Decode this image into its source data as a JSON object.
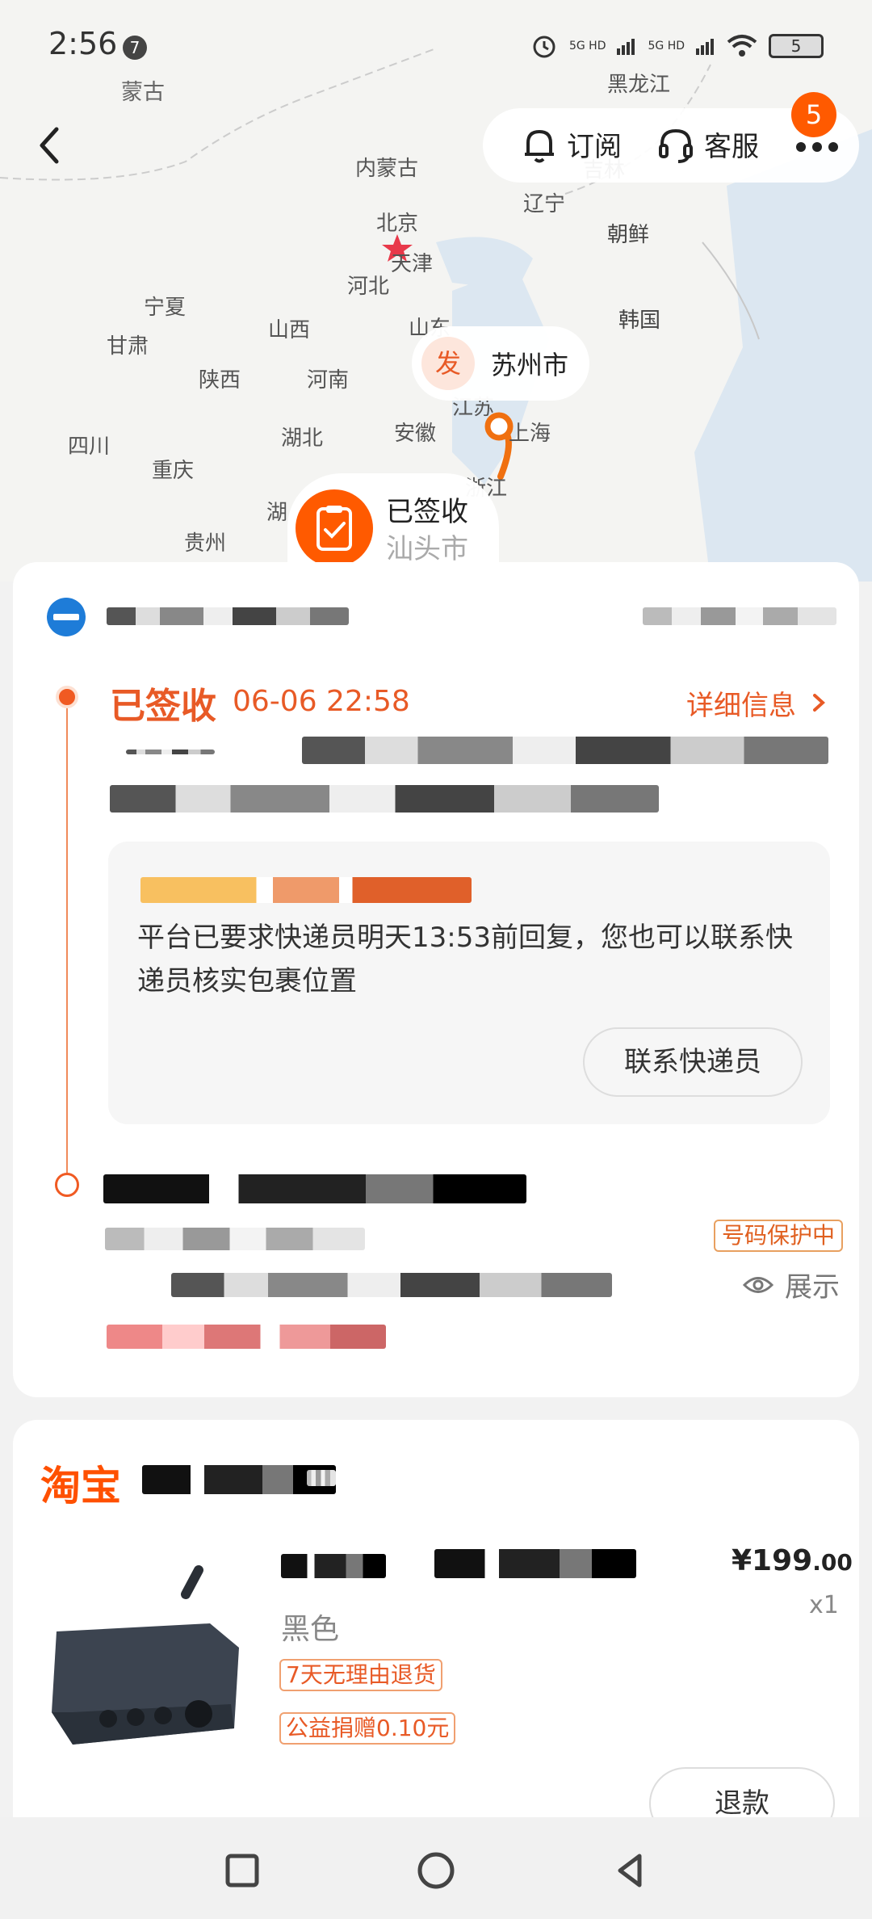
{
  "status_bar": {
    "time": "2:56",
    "notification_count": "7",
    "signal_1": "5G HD",
    "signal_2": "5G HD",
    "battery": "5"
  },
  "map": {
    "labels": [
      "蒙古",
      "黑龙江",
      "内蒙古",
      "吉林",
      "辽宁",
      "朝鲜",
      "北京",
      "天津",
      "河北",
      "宁夏",
      "甘肃",
      "山西",
      "山东",
      "韩国",
      "陕西",
      "河南",
      "四川",
      "湖北",
      "安徽",
      "江苏",
      "上海",
      "重庆",
      "浙江",
      "湖",
      "贵州"
    ]
  },
  "nav": {
    "subscribe_label": "订阅",
    "service_label": "客服",
    "more_badge": "5"
  },
  "route": {
    "origin_tag": "发",
    "origin_city": "苏州市",
    "dest_status": "已签收",
    "dest_city": "汕头市"
  },
  "tracking": {
    "status": "已签收",
    "status_time": "06-06 22:58",
    "detail_link": "详细信息",
    "notice_text": "平台已要求快递员明天13:53前回复，您也可以联系快递员核实包裹位置",
    "contact_button": "联系快递员",
    "number_protection": "号码保护中",
    "show_label": "展示"
  },
  "order": {
    "shop_logo": "淘宝",
    "price_main": "¥199",
    "price_decimal": ".00",
    "quantity": "x1",
    "variant": "黑色",
    "tags": [
      "7天无理由退货",
      "公益捐赠0.10元"
    ],
    "refund_button": "退款"
  },
  "colors": {
    "accent": "#e85a26",
    "brand": "#ff5000",
    "badge": "#ff5a00",
    "route": "#f07010"
  }
}
